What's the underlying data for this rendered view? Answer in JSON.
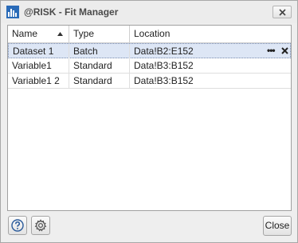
{
  "window": {
    "title": "@RISK - Fit Manager",
    "icons": {
      "app": "risk-chart-icon",
      "close": "close-icon"
    }
  },
  "grid": {
    "columns": [
      {
        "label": "Name",
        "sort": "ascending"
      },
      {
        "label": "Type"
      },
      {
        "label": "Location"
      }
    ],
    "rows": [
      {
        "name": "Dataset 1",
        "type": "Batch",
        "location": "Data!B2:E152",
        "selected": true
      },
      {
        "name": "Variable1",
        "type": "Standard",
        "location": "Data!B3:B152",
        "selected": false
      },
      {
        "name": "Variable1 2",
        "type": "Standard",
        "location": "Data!B3:B152",
        "selected": false
      }
    ],
    "row_actions": {
      "more": "•••",
      "delete_icon": "close-icon"
    }
  },
  "footer": {
    "help_icon": "help-icon",
    "settings_icon": "settings-icon",
    "close_label": "Close"
  },
  "colors": {
    "selection": "#dde6f5",
    "accent": "#2a6bb8"
  }
}
